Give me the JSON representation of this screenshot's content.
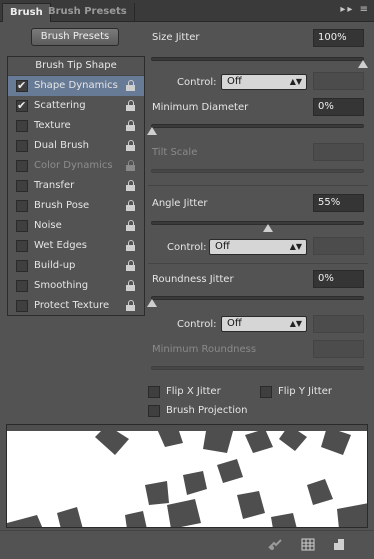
{
  "tabs": [
    {
      "label": "Brush",
      "active": true
    },
    {
      "label": "Brush Presets",
      "active": false
    }
  ],
  "tab_menu_icons": [
    "double-chevron-right-icon",
    "panel-menu-icon"
  ],
  "presets_button": "Brush Presets",
  "list": {
    "header": "Brush Tip Shape",
    "items": [
      {
        "label": "Shape Dynamics",
        "checked": true,
        "selected": true,
        "disabled": false
      },
      {
        "label": "Scattering",
        "checked": true,
        "selected": false,
        "disabled": false
      },
      {
        "label": "Texture",
        "checked": false,
        "selected": false,
        "disabled": false
      },
      {
        "label": "Dual Brush",
        "checked": false,
        "selected": false,
        "disabled": false
      },
      {
        "label": "Color Dynamics",
        "checked": false,
        "selected": false,
        "disabled": true
      },
      {
        "label": "Transfer",
        "checked": false,
        "selected": false,
        "disabled": false
      },
      {
        "label": "Brush Pose",
        "checked": false,
        "selected": false,
        "disabled": false
      },
      {
        "label": "Noise",
        "checked": false,
        "selected": false,
        "disabled": false
      },
      {
        "label": "Wet Edges",
        "checked": false,
        "selected": false,
        "disabled": false
      },
      {
        "label": "Build-up",
        "checked": false,
        "selected": false,
        "disabled": false
      },
      {
        "label": "Smoothing",
        "checked": false,
        "selected": false,
        "disabled": false
      },
      {
        "label": "Protect Texture",
        "checked": false,
        "selected": false,
        "disabled": false
      }
    ]
  },
  "size_jitter": {
    "label": "Size Jitter",
    "value": "100%",
    "fraction": 1.0
  },
  "size_control": {
    "label": "Control:",
    "value": "Off"
  },
  "min_diameter": {
    "label": "Minimum Diameter",
    "value": "0%",
    "fraction": 0.0
  },
  "tilt_scale": {
    "label": "Tilt Scale",
    "disabled": true
  },
  "angle_jitter": {
    "label": "Angle Jitter",
    "value": "55%",
    "fraction": 0.55
  },
  "angle_control": {
    "label": "Control:",
    "value": "Off"
  },
  "roundness_jitter": {
    "label": "Roundness Jitter",
    "value": "0%",
    "fraction": 0.0
  },
  "roundness_control": {
    "label": "Control:",
    "value": "Off"
  },
  "min_roundness": {
    "label": "Minimum Roundness",
    "disabled": true
  },
  "flip_x": {
    "label": "Flip X Jitter",
    "checked": false
  },
  "flip_y": {
    "label": "Flip Y Jitter",
    "checked": false
  },
  "brush_projection": {
    "label": "Brush Projection",
    "checked": false
  },
  "bottom_icons": [
    "brush-visibility-icon",
    "grid-icon",
    "new-preset-icon"
  ],
  "colors": {
    "panel": "#535353",
    "selected_row": "#687b96",
    "tab_bar": "#3a3a3a",
    "preview_bg": "#ffffff",
    "preview_shape": "#4e4e4e"
  }
}
